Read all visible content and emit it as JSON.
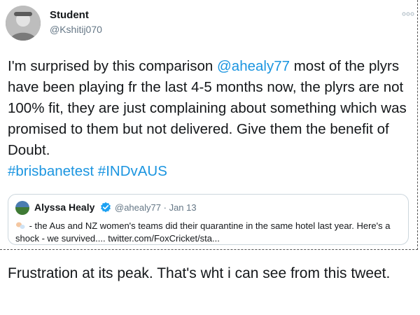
{
  "tweet": {
    "display_name": "Student",
    "handle": "@Kshitij070",
    "body_part1": "I'm surprised by this comparison ",
    "mention": "@ahealy77",
    "body_part2": " most of the plyrs have been playing fr the last 4-5 months now, the plyrs are not 100% fit, they are just complaining about something which was promised to them but not delivered. Give them the benefit of Doubt.",
    "hashtag1": "#brisbanetest",
    "hashtag2": "#INDvAUS",
    "more_icon": "more-dots-icon"
  },
  "quote": {
    "display_name": "Alyssa Healy",
    "verified_icon": "verified-badge-icon",
    "handle": "@ahealy77",
    "separator": "·",
    "date": "Jan 13",
    "text": " - the Aus and NZ women's teams did their quarantine in the same hotel last year. Here's a shock - we survived.... twitter.com/FoxCricket/sta..."
  },
  "caption": "Frustration at its peak. That's wht i can see from this tweet.",
  "colors": {
    "link": "#1b95e0",
    "secondary_text": "#657786",
    "text": "#14171a",
    "border": "#ccd6dd"
  }
}
